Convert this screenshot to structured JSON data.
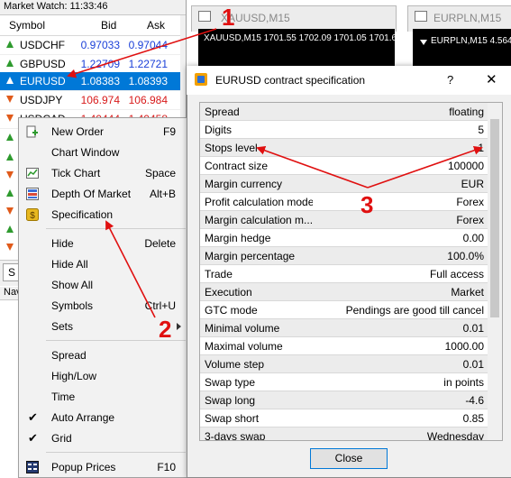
{
  "market_watch": {
    "title": "Market Watch: 11:33:46",
    "col_symbol": "Symbol",
    "col_bid": "Bid",
    "col_ask": "Ask",
    "rows": [
      {
        "symbol": "USDCHF",
        "bid": "0.97033",
        "ask": "0.97044",
        "dir": "up",
        "color": "blue"
      },
      {
        "symbol": "GBPUSD",
        "bid": "1.22709",
        "ask": "1.22721",
        "dir": "up",
        "color": "blue"
      },
      {
        "symbol": "EURUSD",
        "bid": "1.08383",
        "ask": "1.08393",
        "dir": "up",
        "color": "selected"
      },
      {
        "symbol": "USDJPY",
        "bid": "106.974",
        "ask": "106.984",
        "dir": "down",
        "color": "red"
      },
      {
        "symbol": "USDCAD",
        "bid": "1.40444",
        "ask": "1.40458",
        "dir": "down",
        "color": "red"
      }
    ],
    "tab_label": "S",
    "navigator_label": "Nav"
  },
  "charts": [
    {
      "tab": "XAUUSD,M15",
      "header": "XAUUSD,M15  1701.55 1702.09 1701.05 1701.67"
    },
    {
      "tab": "EURPLN,M15",
      "header": "EURPLN,M15  4.564"
    }
  ],
  "context_menu": {
    "items": [
      {
        "label": "New Order",
        "shortcut": "F9",
        "icon": "new-order-icon"
      },
      {
        "label": "Chart Window",
        "shortcut": "",
        "icon": ""
      },
      {
        "label": "Tick Chart",
        "shortcut": "Space",
        "icon": "tick-chart-icon"
      },
      {
        "label": "Depth Of Market",
        "shortcut": "Alt+B",
        "icon": "depth-of-market-icon"
      },
      {
        "label": "Specification",
        "shortcut": "",
        "icon": "specification-icon"
      },
      {
        "label": "Hide",
        "shortcut": "Delete",
        "icon": ""
      },
      {
        "label": "Hide All",
        "shortcut": "",
        "icon": ""
      },
      {
        "label": "Show All",
        "shortcut": "",
        "icon": ""
      },
      {
        "label": "Symbols",
        "shortcut": "Ctrl+U",
        "icon": ""
      },
      {
        "label": "Sets",
        "shortcut": "",
        "icon": ""
      },
      {
        "label": "Spread",
        "shortcut": "",
        "icon": ""
      },
      {
        "label": "High/Low",
        "shortcut": "",
        "icon": ""
      },
      {
        "label": "Time",
        "shortcut": "",
        "icon": ""
      },
      {
        "label": "Auto Arrange",
        "shortcut": "",
        "icon": "check-icon"
      },
      {
        "label": "Grid",
        "shortcut": "",
        "icon": "check-icon"
      },
      {
        "label": "Popup Prices",
        "shortcut": "F10",
        "icon": "popup-prices-icon"
      }
    ]
  },
  "dialog": {
    "title": "EURUSD contract specification",
    "help": "?",
    "close_glyph": "✕",
    "close_button": "Close",
    "specs": [
      {
        "key": "Spread",
        "value": "floating"
      },
      {
        "key": "Digits",
        "value": "5"
      },
      {
        "key": "Stops level",
        "value": "1"
      },
      {
        "key": "Contract size",
        "value": "100000"
      },
      {
        "key": "Margin currency",
        "value": "EUR"
      },
      {
        "key": "Profit calculation mode",
        "value": "Forex"
      },
      {
        "key": "Margin calculation m...",
        "value": "Forex"
      },
      {
        "key": "Margin hedge",
        "value": "0.00"
      },
      {
        "key": "Margin percentage",
        "value": "100.0%"
      },
      {
        "key": "Trade",
        "value": "Full access"
      },
      {
        "key": "Execution",
        "value": "Market"
      },
      {
        "key": "GTC mode",
        "value": "Pendings are good till cancel"
      },
      {
        "key": "Minimal volume",
        "value": "0.01"
      },
      {
        "key": "Maximal volume",
        "value": "1000.00"
      },
      {
        "key": "Volume step",
        "value": "0.01"
      },
      {
        "key": "Swap type",
        "value": "in points"
      },
      {
        "key": "Swap long",
        "value": "-4.6"
      },
      {
        "key": "Swap short",
        "value": "0.85"
      },
      {
        "key": "3-days swap",
        "value": "Wednesday"
      }
    ]
  },
  "annotations": {
    "n1": "1",
    "n2": "2",
    "n3": "3",
    "color": "#e01010"
  }
}
